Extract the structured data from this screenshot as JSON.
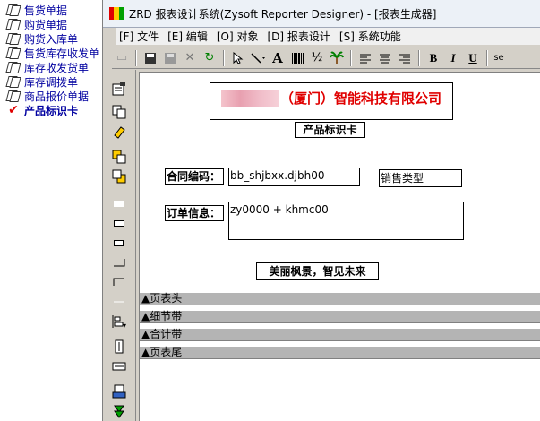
{
  "tree": {
    "items": [
      {
        "label": "售货单据"
      },
      {
        "label": "购货单据"
      },
      {
        "label": "购货入库单"
      },
      {
        "label": "售货库存收发单"
      },
      {
        "label": "库存收发货单"
      },
      {
        "label": "库存调拨单"
      },
      {
        "label": "商品报价单据"
      },
      {
        "label": "产品标识卡",
        "selected": true
      }
    ]
  },
  "window": {
    "title": "ZRD 报表设计系统(Zysoft  Reporter  Designer) - [报表生成器]"
  },
  "menu": {
    "items": [
      {
        "label": "[F] 文件"
      },
      {
        "label": "[E] 编辑"
      },
      {
        "label": "[O] 对象"
      },
      {
        "label": "[D] 报表设计"
      },
      {
        "label": "[S] 系统功能"
      }
    ]
  },
  "toolbar": {
    "buttons": [
      "open-icon",
      "save-icon",
      "save-disabled-icon",
      "close-icon",
      "refresh-icon",
      "pointer-icon",
      "line-icon",
      "text-icon",
      "barcode-icon",
      "fraction-icon",
      "palm-icon",
      "align-left-icon",
      "align-center-icon",
      "align-right-icon",
      "bold-icon",
      "italic-icon",
      "underline-icon"
    ],
    "bold": "B",
    "italic": "I",
    "underline": "U",
    "text_tool": "A",
    "extra": "se"
  },
  "report": {
    "company_suffix": "（厦门）智能科技有限公司",
    "card_title": "产品标识卡",
    "contract_label": "合同编码：",
    "contract_value": "bb_shjbxx.djbh00",
    "sales_type": "销售类型",
    "order_label": "订单信息：",
    "order_value": "zy0000 + khmc00",
    "slogan": "美丽枫景，智见未来"
  },
  "bands": [
    {
      "label": "▲页表头"
    },
    {
      "label": "▲细节带"
    },
    {
      "label": "▲合计带"
    },
    {
      "label": "▲页表尾"
    }
  ],
  "colors": {
    "company_red": "#e00000",
    "tree_text": "#0000a0",
    "band_gray": "#b4b4b4"
  }
}
